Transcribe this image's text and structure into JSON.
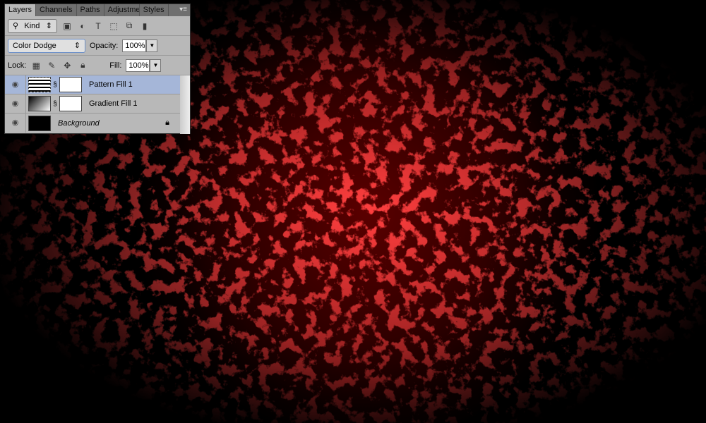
{
  "panel": {
    "tabs": [
      "Layers",
      "Channels",
      "Paths",
      "Adjustme",
      "Styles"
    ],
    "filter_label": "Kind",
    "blend_mode": "Color Dodge",
    "opacity_label": "Opacity:",
    "opacity_value": "100%",
    "lock_label": "Lock:",
    "fill_label": "Fill:",
    "fill_value": "100%",
    "layers": [
      {
        "name": "Pattern Fill 1",
        "selected": true,
        "visible": true
      },
      {
        "name": "Gradient Fill 1",
        "selected": false,
        "visible": true
      },
      {
        "name": "Background",
        "selected": false,
        "visible": true,
        "locked": true
      }
    ]
  },
  "colors": {
    "texture": "#e00000",
    "selection": "#a5b6d8"
  }
}
